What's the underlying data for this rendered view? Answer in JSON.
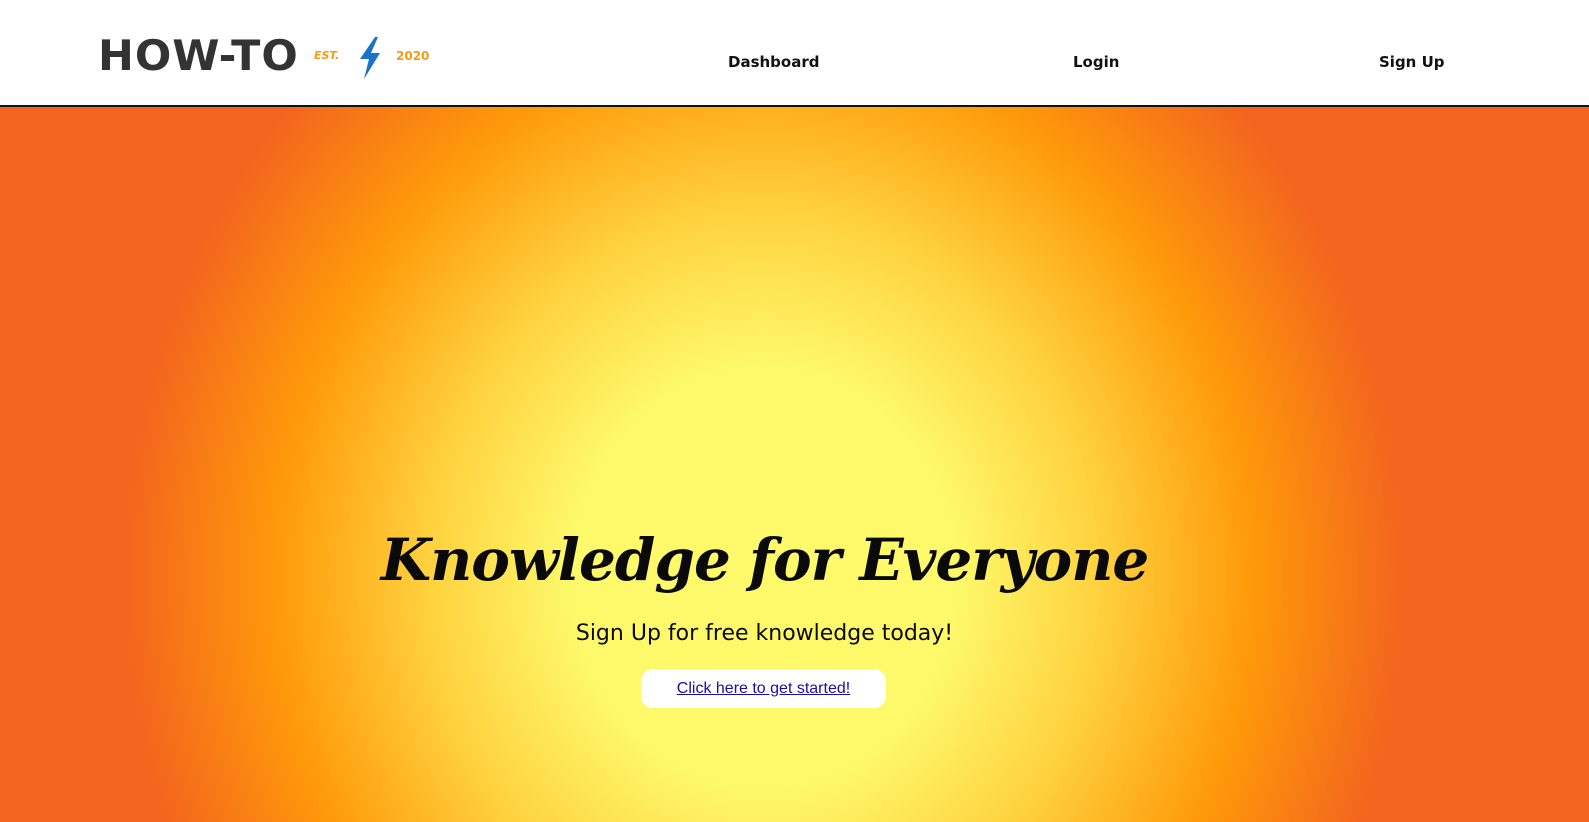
{
  "header": {
    "logo_text": "HOW-TO",
    "est_label": "EST.",
    "year_label": "2020",
    "logo_icon": "lightning-bolt-icon",
    "nav": [
      {
        "label": "Dashboard"
      },
      {
        "label": "Login"
      },
      {
        "label": "Sign Up"
      }
    ]
  },
  "hero": {
    "title": "Knowledge for Everyone",
    "subtitle": "Sign Up for free knowledge today!",
    "cta_label": "Click here to get started!"
  },
  "colors": {
    "accent_orange": "#f39c12",
    "bolt_blue": "#1a73c8",
    "gradient_center": "#fdf96b",
    "gradient_edge": "#f3651e",
    "link": "#1a0dab"
  }
}
